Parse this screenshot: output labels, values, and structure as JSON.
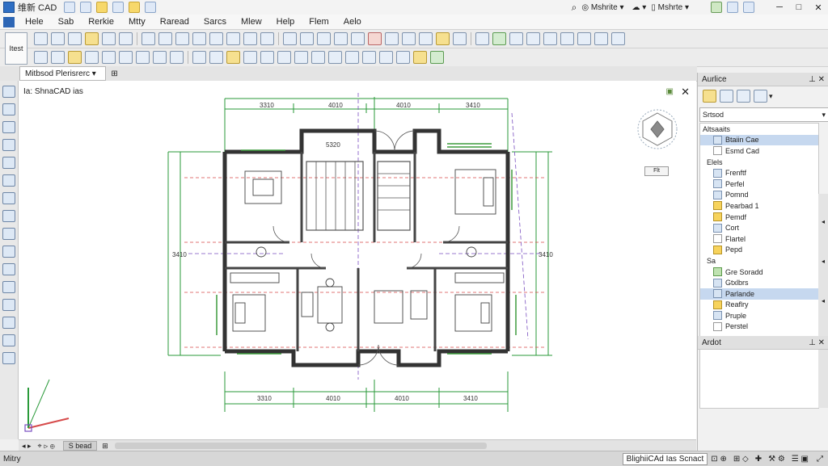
{
  "window": {
    "title": "维新 CAD",
    "right_items": [
      "Mshrite",
      "Mshrte"
    ]
  },
  "menu": [
    "Hele",
    "Sab",
    "Rerkie",
    "Mtty",
    "Raread",
    "Sarcs",
    "Mlew",
    "Help",
    "Flem",
    "Aelo"
  ],
  "toolbar": {
    "large_button": "Itest"
  },
  "document": {
    "tab_label": "Mitbsod Plerisrerc",
    "view_label": "Ia: ShnaCAD ias",
    "nav_cube_label": "Flt"
  },
  "drawing": {
    "dim_top": [
      "3310",
      "4010",
      "4010",
      "3410"
    ],
    "dim_bottom": [
      "3310",
      "4010",
      "4010",
      "3410"
    ],
    "dim_left": "3410",
    "dim_right": "3410",
    "room_label": "5320"
  },
  "model_bar": {
    "tab": "S bead"
  },
  "status_bar": {
    "left": "Mitry",
    "search": "BlighiiCAd Ias Scnact"
  },
  "right_panel": {
    "title": "Aurlice",
    "search_value": "Srtsod",
    "tree_root": "Altsaaits",
    "items": [
      {
        "label": "Btaiin Cae",
        "swatch": "b",
        "selected": true
      },
      {
        "label": "Esmd Cad",
        "swatch": "w",
        "selected": false
      },
      {
        "label": "Elels",
        "swatch": "",
        "selected": false
      },
      {
        "label": "Frenftf",
        "swatch": "b",
        "selected": false
      },
      {
        "label": "Perfel",
        "swatch": "b",
        "selected": false
      },
      {
        "label": "Pomnd",
        "swatch": "b",
        "selected": false
      },
      {
        "label": "Pearbad 1",
        "swatch": "y",
        "selected": false
      },
      {
        "label": "Pemdf",
        "swatch": "y",
        "selected": false
      },
      {
        "label": "Cort",
        "swatch": "b",
        "selected": false
      },
      {
        "label": "Flartel",
        "swatch": "w",
        "selected": false
      },
      {
        "label": "Pepd",
        "swatch": "y",
        "selected": false
      },
      {
        "label": "Sa",
        "swatch": "",
        "selected": false
      },
      {
        "label": "Gre Soradd",
        "swatch": "g",
        "selected": false
      },
      {
        "label": "Gtxlbrs",
        "swatch": "b",
        "selected": false
      },
      {
        "label": "Parlande",
        "swatch": "b",
        "selected": true
      },
      {
        "label": "Reaflry",
        "swatch": "y",
        "selected": false
      },
      {
        "label": "Pruple",
        "swatch": "b",
        "selected": false
      },
      {
        "label": "Perstel",
        "swatch": "w",
        "selected": false
      }
    ],
    "footer": "Ardot"
  }
}
